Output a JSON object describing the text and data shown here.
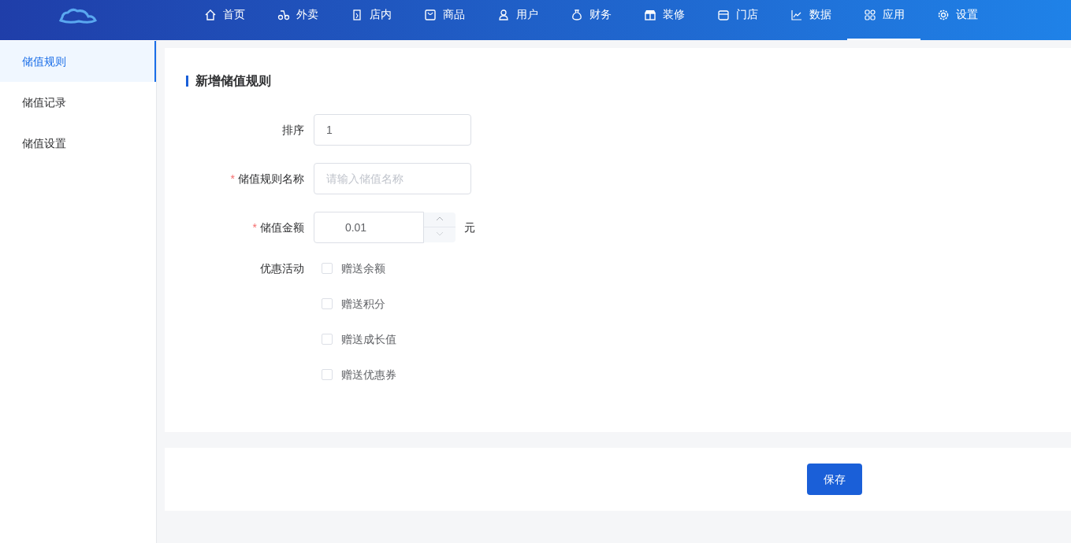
{
  "nav": [
    {
      "label": "首页",
      "selected": false
    },
    {
      "label": "外卖",
      "selected": false
    },
    {
      "label": "店内",
      "selected": false
    },
    {
      "label": "商品",
      "selected": false
    },
    {
      "label": "用户",
      "selected": false
    },
    {
      "label": "财务",
      "selected": false
    },
    {
      "label": "装修",
      "selected": false
    },
    {
      "label": "门店",
      "selected": false
    },
    {
      "label": "数据",
      "selected": false
    },
    {
      "label": "应用",
      "selected": true
    },
    {
      "label": "设置",
      "selected": false
    }
  ],
  "sidebar": {
    "items": [
      {
        "label": "储值规则",
        "selected": true
      },
      {
        "label": "储值记录",
        "selected": false
      },
      {
        "label": "储值设置",
        "selected": false
      }
    ]
  },
  "form": {
    "title": "新增储值规则",
    "required_mark": "*",
    "fields": [
      {
        "kind": "text",
        "label": "排序",
        "required": false,
        "value": "1"
      },
      {
        "kind": "text",
        "label": "储值规则名称",
        "required": true,
        "placeholder": "请输入储值名称"
      },
      {
        "kind": "number",
        "label": "储值金额",
        "required": true,
        "value": "0.01",
        "unit": "元"
      }
    ],
    "promotions": {
      "label": "优惠活动",
      "options": [
        {
          "label": "赠送余额",
          "checked": false
        },
        {
          "label": "赠送积分",
          "checked": false
        },
        {
          "label": "赠送成长值",
          "checked": false
        },
        {
          "label": "赠送优惠券",
          "checked": false
        }
      ]
    }
  },
  "save_button": "保存"
}
